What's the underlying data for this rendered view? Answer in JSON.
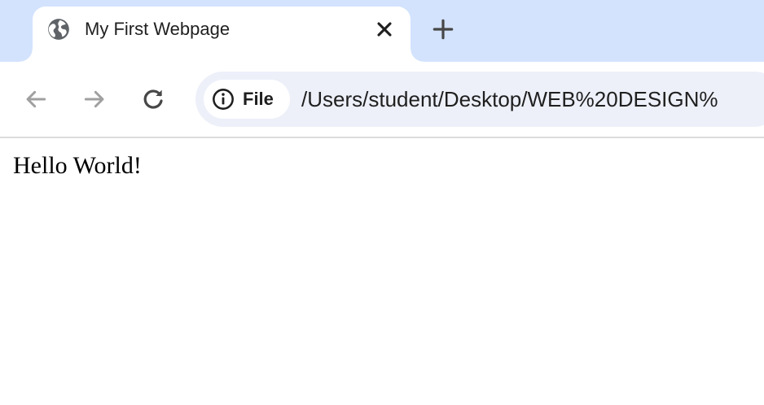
{
  "tab": {
    "title": "My First Webpage",
    "favicon": "globe-icon",
    "close_icon": "close-icon"
  },
  "new_tab": {
    "icon": "plus-icon"
  },
  "toolbar": {
    "back_icon": "arrow-left-icon",
    "forward_icon": "arrow-right-icon",
    "reload_icon": "reload-icon",
    "back_enabled": false,
    "forward_enabled": false
  },
  "omnibox": {
    "chip_icon": "info-icon",
    "chip_label": "File",
    "url": "/Users/student/Desktop/WEB%20DESIGN%"
  },
  "page": {
    "text": "Hello World!"
  },
  "colors": {
    "tabstrip_bg": "#d3e3fd",
    "omnibox_bg": "#edf0f9",
    "disabled_icon": "#a0a0a0",
    "active_icon": "#474747",
    "text": "#1f1f1f"
  }
}
